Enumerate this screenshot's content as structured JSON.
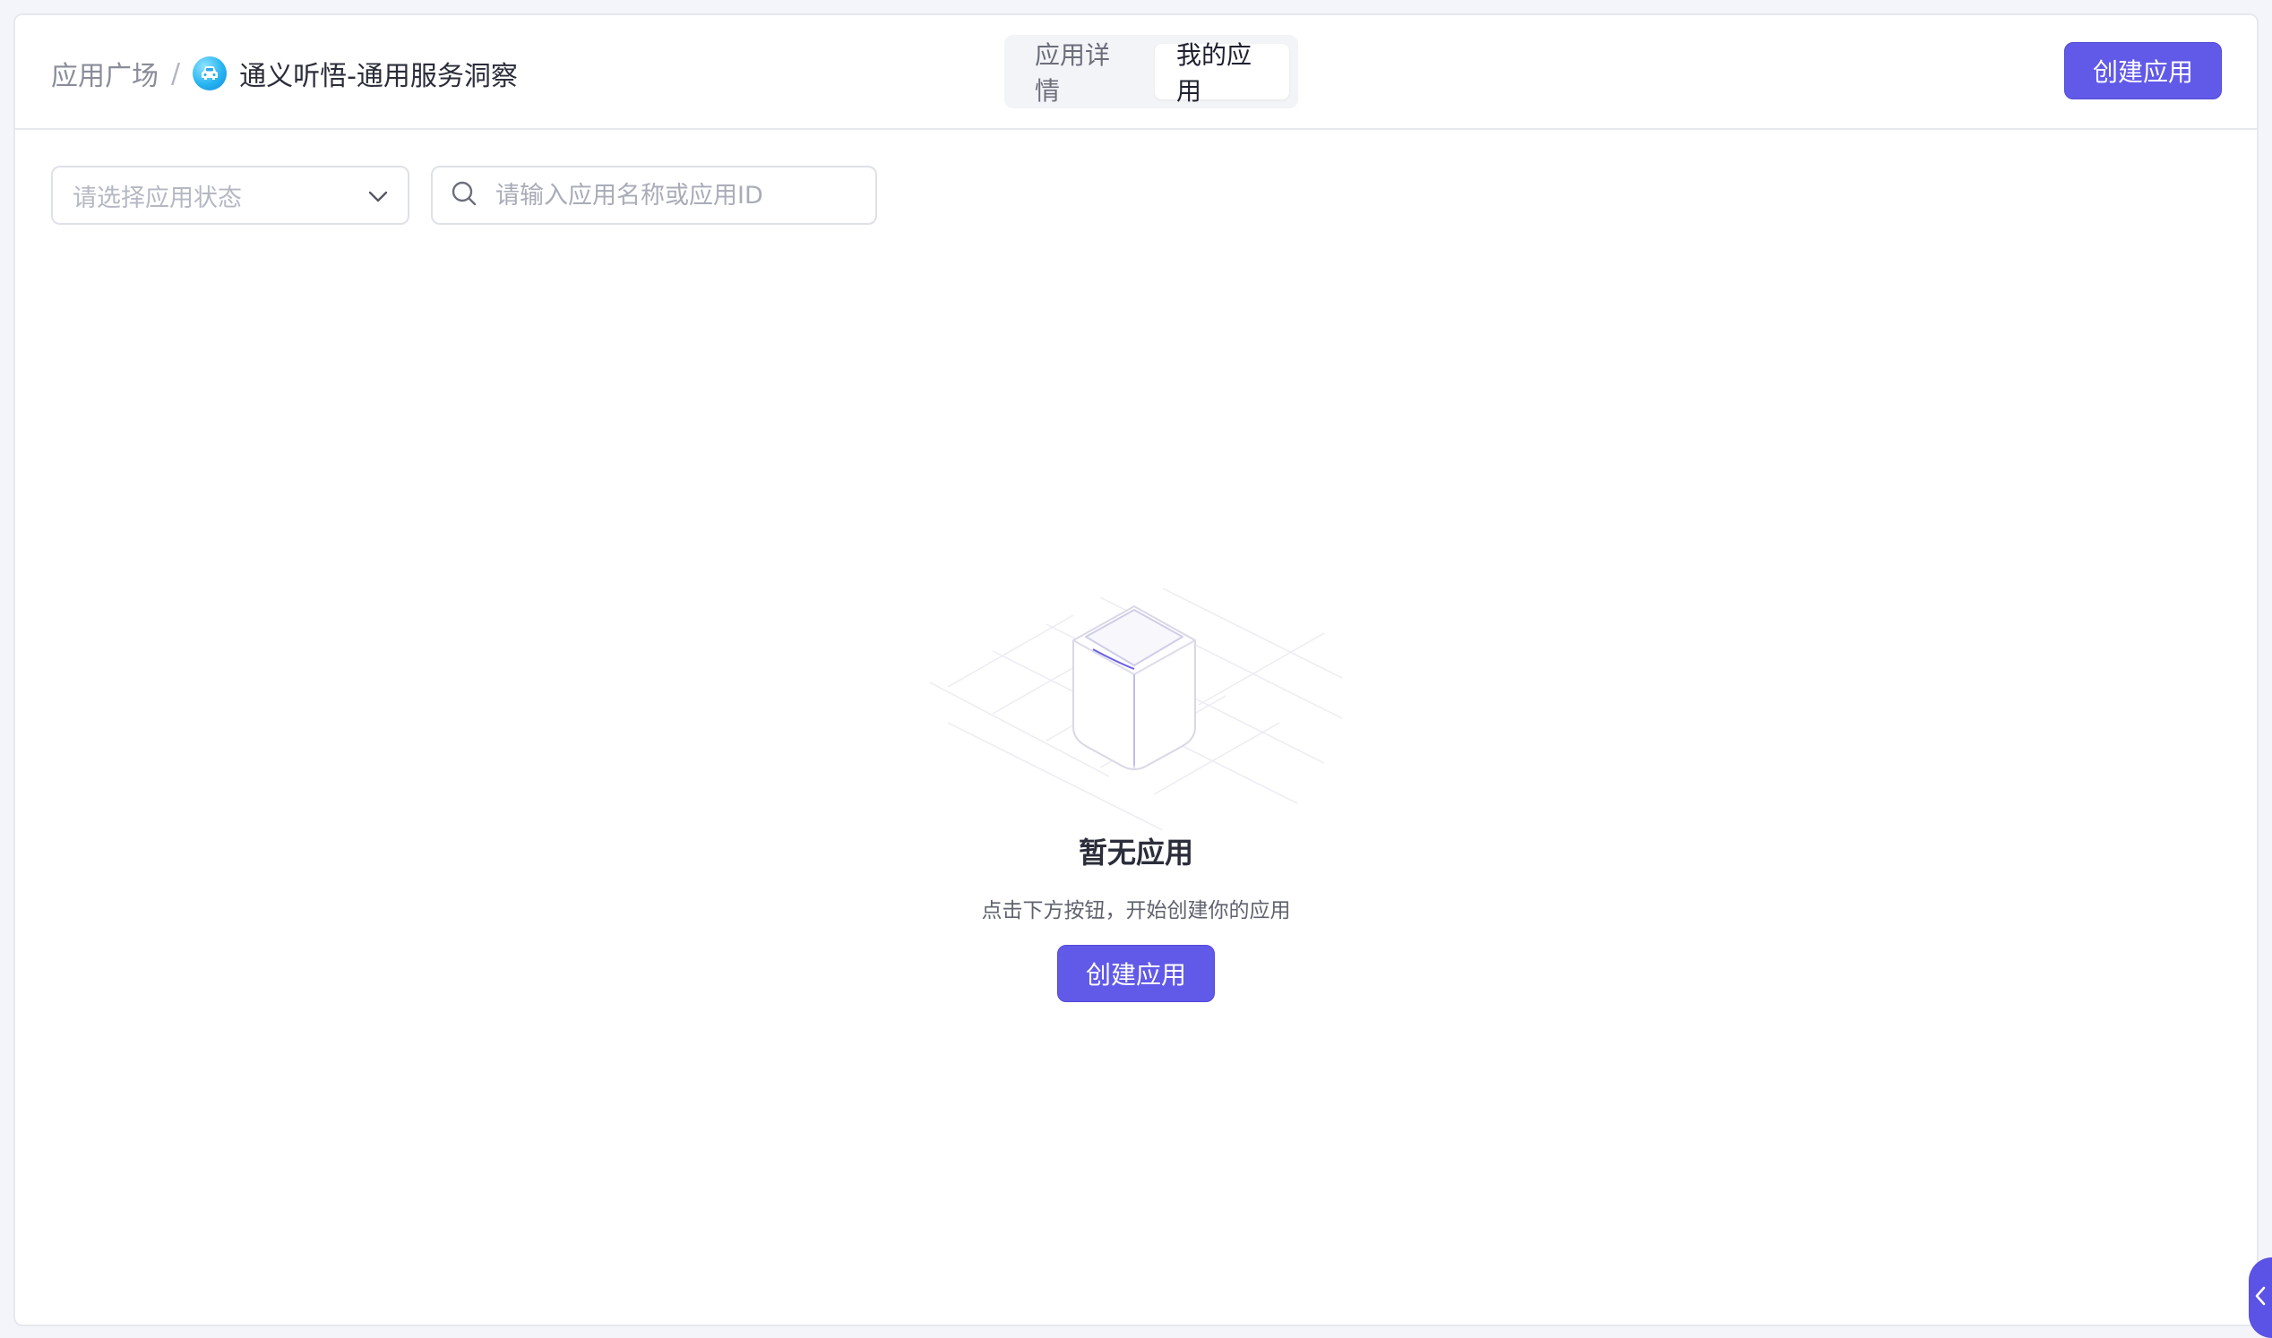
{
  "breadcrumb": {
    "root": "应用广场",
    "separator": "/",
    "current": "通义听悟-通用服务洞察",
    "app_icon": "car-logo-icon"
  },
  "tabs": [
    {
      "label": "应用详情",
      "active": false
    },
    {
      "label": "我的应用",
      "active": true
    }
  ],
  "header": {
    "create_label": "创建应用"
  },
  "filters": {
    "status_placeholder": "请选择应用状态",
    "search_placeholder": "请输入应用名称或应用ID"
  },
  "empty_state": {
    "title": "暂无应用",
    "description": "点击下方按钮，开始创建你的应用",
    "create_label": "创建应用",
    "illustration": "empty-box-icon"
  },
  "colors": {
    "primary": "#6159e8",
    "page_bg": "#f4f5fa",
    "border": "#e6e8ef"
  },
  "icons": {
    "dropdown": "chevron-down-icon",
    "search": "search-icon",
    "collapse": "chevron-left-icon"
  }
}
